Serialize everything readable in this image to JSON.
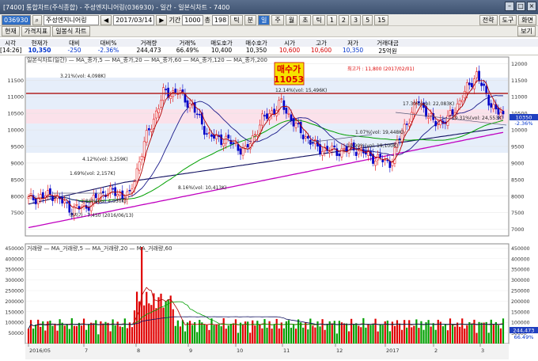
{
  "window": {
    "title": "[7400] 통합차트(주식종합) - 주성엔지니어링(036930) - 일간 - 일본식차트 - 7400",
    "buttons": [
      "–",
      "□",
      "×"
    ]
  },
  "toolbar": {
    "code": "036930",
    "search_icon": "search-icon",
    "stock_name": "주성엔지니어링",
    "date": "2017/03/14",
    "period_label": "기간",
    "period_value": "1000",
    "count_label": "총",
    "count_value": "198",
    "intervals": [
      "틱",
      "분",
      "일",
      "주",
      "월",
      "초",
      "틱",
      "1",
      "2",
      "3",
      "5",
      "15"
    ],
    "right_buttons": [
      "전략",
      "도구",
      "화면"
    ]
  },
  "toolbar2": {
    "items": [
      "현재",
      "가격지표",
      "일봉식 차트"
    ],
    "view_button": "보기"
  },
  "quote": {
    "headers": [
      "시각",
      "현재가",
      "대비",
      "대비%",
      "거래량",
      "거래%",
      "매도호가",
      "매수호가",
      "시가",
      "고가",
      "저가",
      "거래대금"
    ],
    "values": [
      "[14:26]",
      "10,350",
      "-250",
      "-2.36%",
      "244,473",
      "66.49%",
      "10,400",
      "10,350",
      "10,600",
      "10,600",
      "10,350",
      "25억원"
    ]
  },
  "price_panel": {
    "legend": "일본식차트(일간) — MA_종가,5 — MA_종가,20 — MA_종가,60 — MA_종가,120 — MA_종가,200",
    "y_ticks": [
      "12000",
      "11500",
      "11000",
      "10500",
      "10000",
      "9500",
      "9000",
      "8500",
      "8000",
      "7500",
      "7000"
    ],
    "left_ticks": [
      "11500",
      "11000",
      "10500",
      "10000",
      "9500",
      "9000",
      "8500",
      "8000",
      "7500"
    ],
    "buy_box_title": "매수가",
    "buy_box_price": "11053",
    "annotations": [
      "3.21%(vol: 4,098K)",
      "12.14%(vol: 15,496K)",
      "4.12%(vol: 3,259K)",
      "1.69%(vol: 2,157K)",
      "8.16%(vol: 10,413K)",
      "-1.86%(vol: 4,930K)",
      "최저가 : 7,450 (2016/06/13)",
      "최고가 : 11,800 (2017/02/01)",
      "17.30%(vol: 22,083K)",
      "19.31%(vol: 24,553K)",
      "1.07%(vol: 19,448K)",
      "14.90%(vol: 19,100K)"
    ],
    "current_price_tag": "10350",
    "current_pct_tag": "-2.36%"
  },
  "volume_panel": {
    "legend": "거래량 — MA_거래량,5 — MA_거래량,20 — MA_거래량,60",
    "y_ticks": [
      "450000",
      "400000",
      "350000",
      "300000",
      "250000",
      "200000",
      "150000",
      "100000",
      "50000"
    ],
    "volume_tag": "244,473",
    "volume_pct_tag": "66.49%"
  },
  "x_axis": [
    "2016/05",
    "7",
    "8",
    "9",
    "10",
    "11",
    "12",
    "2017",
    "2",
    "3"
  ],
  "colors": {
    "up": "#e00000",
    "down": "#0000c8",
    "ma5": "#b00000",
    "ma20": "#1a1a8a",
    "ma60": "#00a000",
    "ma120": "#101060",
    "ma200": "#c000c0",
    "resistance": "#b22222",
    "band_pink": "#fbe1ea",
    "band_blue": "#e6eefa",
    "buy_box_bg": "#f6e300"
  }
}
